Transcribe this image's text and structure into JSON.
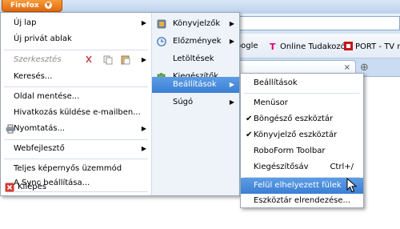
{
  "firefox_button": {
    "label": "Firefox"
  },
  "bookmarks": [
    {
      "label": "oogle",
      "icon": "bookmark-page-icon"
    },
    {
      "label": "Online Tudakozó",
      "icon": "t-mobile-icon"
    },
    {
      "label": "PORT - TV mű",
      "icon": "port-icon"
    }
  ],
  "tab": {
    "close": "×",
    "new_tab": "⊕"
  },
  "main_menu": {
    "left": [
      {
        "label": "Új lap",
        "submenu": true
      },
      {
        "label": "Új privát ablak"
      },
      {
        "label": "Szerkesztés",
        "dim": true
      },
      {
        "label": "Keresés..."
      },
      {
        "label": "Oldal mentése..."
      },
      {
        "label": "Hivatkozás küldése e-mailben..."
      },
      {
        "label": "Nyomtatás...",
        "submenu": true
      },
      {
        "label": "Webfejlesztő",
        "submenu": true
      },
      {
        "label": "Teljes képernyős üzemmód"
      },
      {
        "label": "A Sync beállítása..."
      },
      {
        "label": "Kilépés"
      }
    ],
    "right": [
      {
        "label": "Könyvjelzők",
        "submenu": true
      },
      {
        "label": "Előzmények",
        "submenu": true
      },
      {
        "label": "Letöltések"
      },
      {
        "label": "Kiegészítők"
      },
      {
        "label": "Beállítások",
        "submenu": true
      },
      {
        "label": "Súgó",
        "submenu": true
      }
    ]
  },
  "options_menu": {
    "items": [
      {
        "label": "Beállítások"
      },
      {
        "label": "Menüsor"
      },
      {
        "label": "Böngésző eszköztár",
        "checked": true
      },
      {
        "label": "Könyvjelző eszköztár",
        "checked": true
      },
      {
        "label": "RoboForm Toolbar"
      },
      {
        "label": "Kiegészítősáv",
        "shortcut": "Ctrl+/"
      },
      {
        "label": "Felül elhelyezett fülek"
      },
      {
        "label": "Eszköztár elrendezése..."
      }
    ]
  },
  "glyphs": {
    "arrow": "▶",
    "check": "✔"
  }
}
